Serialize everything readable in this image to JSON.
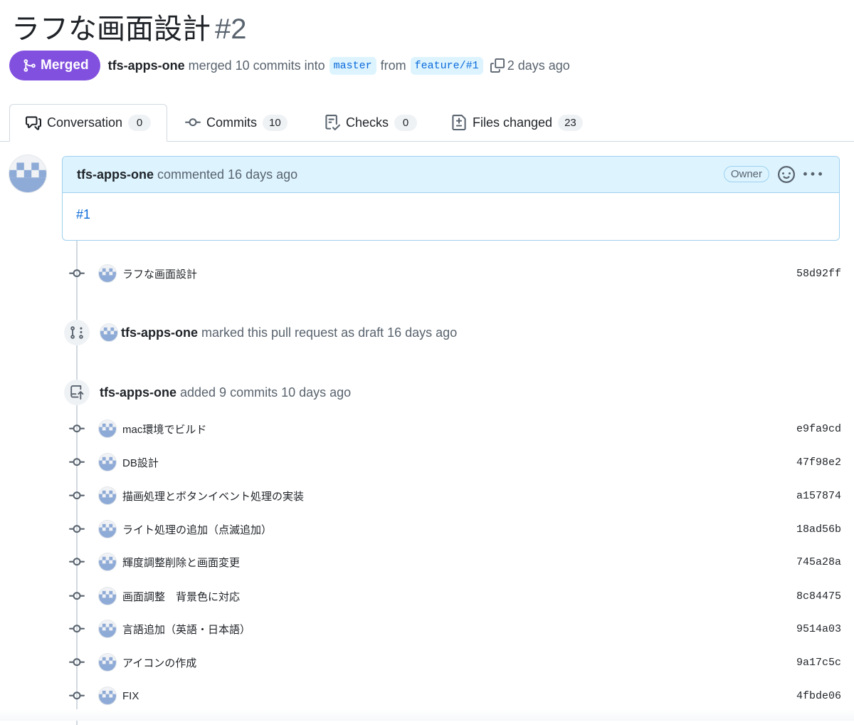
{
  "pr": {
    "title": "ラフな画面設計",
    "number": "#2",
    "state": "Merged",
    "author": "tfs-apps-one",
    "merge_text_1": "merged 10 commits into",
    "base_branch": "master",
    "merge_text_2": "from",
    "head_branch": "feature/#1",
    "merged_ago": "2 days ago"
  },
  "tabs": [
    {
      "label": "Conversation",
      "count": "0",
      "icon": "comment-discussion-icon"
    },
    {
      "label": "Commits",
      "count": "10",
      "icon": "git-commit-icon"
    },
    {
      "label": "Checks",
      "count": "0",
      "icon": "checklist-icon"
    },
    {
      "label": "Files changed",
      "count": "23",
      "icon": "file-diff-icon"
    }
  ],
  "comment": {
    "author": "tfs-apps-one",
    "action": "commented 16 days ago",
    "badge": "Owner",
    "body": "#1"
  },
  "first_commit": {
    "message": "ラフな画面設計",
    "sha": "58d92ff"
  },
  "draft_event": {
    "author": "tfs-apps-one",
    "text": "marked this pull request as draft 16 days ago"
  },
  "push_event": {
    "author": "tfs-apps-one",
    "text": "added 9 commits 10 days ago"
  },
  "commits": [
    {
      "message": "mac環境でビルド",
      "sha": "e9fa9cd"
    },
    {
      "message": "DB設計",
      "sha": "47f98e2"
    },
    {
      "message": "描画処理とボタンイベント処理の実装",
      "sha": "a157874"
    },
    {
      "message": "ライト処理の追加（点滅追加）",
      "sha": "18ad56b"
    },
    {
      "message": "輝度調整削除と画面変更",
      "sha": "745a28a"
    },
    {
      "message": "画面調整　背景色に対応",
      "sha": "8c84475"
    },
    {
      "message": "言語追加（英語・日本語）",
      "sha": "9514a03"
    },
    {
      "message": "アイコンの作成",
      "sha": "9a17c5c"
    },
    {
      "message": "FIX",
      "sha": "4fbde06"
    }
  ],
  "colors": {
    "merged": "#8250df",
    "link": "#0969da",
    "branch_bg": "#ddf4ff",
    "comment_header_bg": "#ddf4ff",
    "avatar_blue": "#8eaad6"
  }
}
